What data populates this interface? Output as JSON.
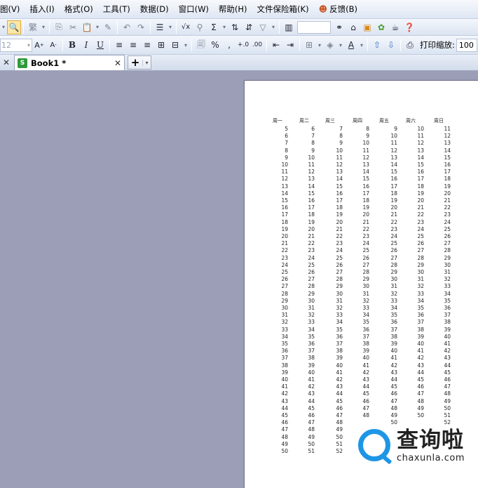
{
  "menu": {
    "items": [
      "图(V)",
      "插入(I)",
      "格式(O)",
      "工具(T)",
      "数据(D)",
      "窗口(W)",
      "帮助(H)",
      "文件保险箱(K)"
    ],
    "feedback": "反馈(B)"
  },
  "toolbar2": {
    "font_size": "12",
    "zoom_label": "打印缩放:",
    "zoom_value": "100"
  },
  "tabs": {
    "document": "Book1 *",
    "excel_badge": "S"
  },
  "sheet": {
    "headers": [
      "周一",
      "周二",
      "周三",
      "周四",
      "周五",
      "周六",
      "周日"
    ],
    "columns": [
      [
        "5",
        "6",
        "7",
        "8",
        "9",
        "10",
        "11",
        "12",
        "13",
        "14",
        "15",
        "16",
        "17",
        "18",
        "19",
        "20",
        "21",
        "22",
        "23",
        "24",
        "25",
        "26",
        "27",
        "28",
        "29",
        "30",
        "31",
        "32",
        "33",
        "34",
        "35",
        "36",
        "37",
        "38",
        "39",
        "40",
        "41",
        "42",
        "43",
        "44",
        "45",
        "46",
        "47",
        "48",
        "49",
        "50"
      ],
      [
        "6",
        "7",
        "8",
        "9",
        "10",
        "11",
        "12",
        "13",
        "14",
        "15",
        "16",
        "17",
        "18",
        "19",
        "20",
        "21",
        "22",
        "23",
        "24",
        "25",
        "26",
        "27",
        "28",
        "29",
        "30",
        "31",
        "32",
        "33",
        "34",
        "35",
        "36",
        "37",
        "38",
        "39",
        "40",
        "41",
        "42",
        "43",
        "44",
        "45",
        "46",
        "47",
        "48",
        "49",
        "50",
        "51"
      ],
      [
        "7",
        "8",
        "9",
        "10",
        "11",
        "12",
        "13",
        "14",
        "15",
        "16",
        "17",
        "18",
        "19",
        "20",
        "21",
        "22",
        "23",
        "24",
        "25",
        "26",
        "27",
        "28",
        "29",
        "30",
        "31",
        "32",
        "33",
        "34",
        "35",
        "36",
        "37",
        "38",
        "39",
        "40",
        "41",
        "42",
        "43",
        "44",
        "45",
        "46",
        "47",
        "48",
        "49",
        "50",
        "51",
        "52"
      ],
      [
        "8",
        "9",
        "10",
        "11",
        "12",
        "13",
        "14",
        "15",
        "16",
        "17",
        "18",
        "19",
        "20",
        "21",
        "22",
        "23",
        "24",
        "25",
        "26",
        "27",
        "28",
        "29",
        "30",
        "31",
        "32",
        "33",
        "34",
        "35",
        "36",
        "37",
        "38",
        "39",
        "40",
        "41",
        "42",
        "43",
        "44",
        "45",
        "46",
        "47",
        "48"
      ],
      [
        "9",
        "10",
        "11",
        "12",
        "13",
        "14",
        "15",
        "16",
        "17",
        "18",
        "19",
        "20",
        "21",
        "22",
        "23",
        "24",
        "25",
        "26",
        "27",
        "28",
        "29",
        "30",
        "31",
        "32",
        "33",
        "34",
        "35",
        "36",
        "37",
        "38",
        "39",
        "40",
        "41",
        "42",
        "43",
        "44",
        "45",
        "46",
        "47",
        "48",
        "49",
        "50"
      ],
      [
        "10",
        "11",
        "12",
        "13",
        "14",
        "15",
        "16",
        "17",
        "18",
        "19",
        "20",
        "21",
        "22",
        "23",
        "24",
        "25",
        "26",
        "27",
        "28",
        "29",
        "30",
        "31",
        "32",
        "33",
        "34",
        "35",
        "36",
        "37",
        "38",
        "39",
        "40",
        "41",
        "42",
        "43",
        "44",
        "45",
        "46",
        "47",
        "48",
        "49",
        "50"
      ],
      [
        "11",
        "12",
        "13",
        "14",
        "15",
        "16",
        "17",
        "18",
        "19",
        "20",
        "21",
        "22",
        "23",
        "24",
        "25",
        "26",
        "27",
        "28",
        "29",
        "30",
        "31",
        "32",
        "33",
        "34",
        "35",
        "36",
        "37",
        "38",
        "39",
        "40",
        "41",
        "42",
        "43",
        "44",
        "45",
        "46",
        "47",
        "48",
        "49",
        "50",
        "51",
        "52"
      ]
    ]
  },
  "watermark": {
    "brand_cn": "查询啦",
    "brand_url": "chaxunla.com"
  }
}
